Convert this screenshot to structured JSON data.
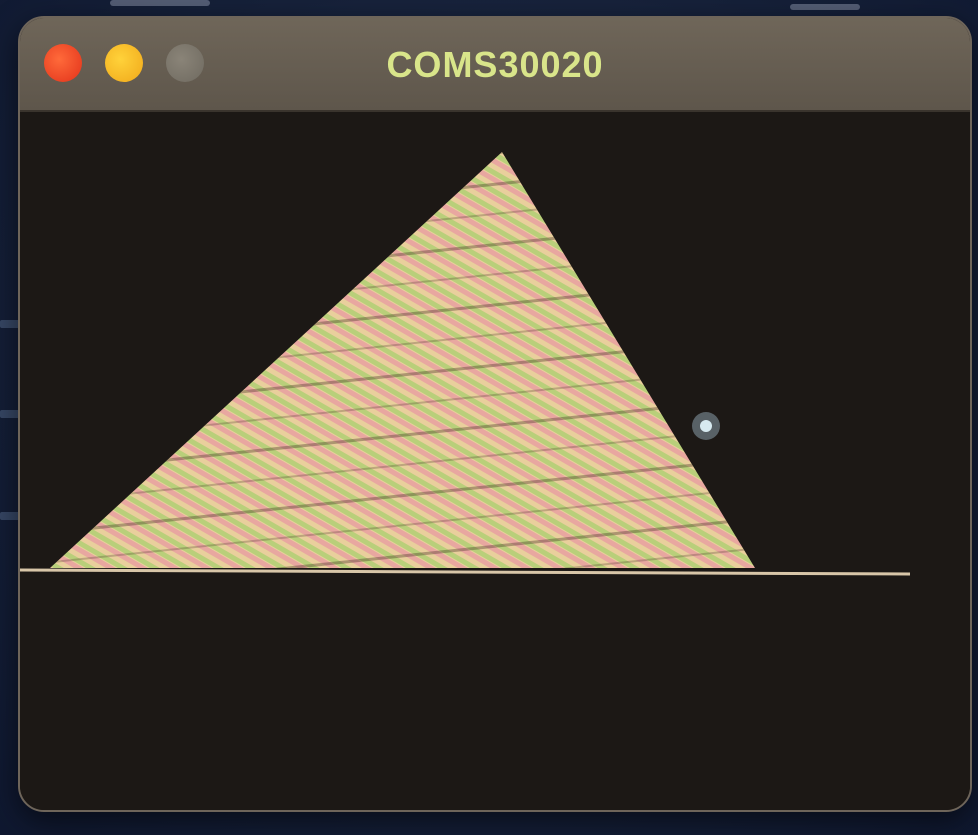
{
  "window": {
    "title": "COMS30020",
    "controls": {
      "close": "close-button",
      "minimize": "minimize-button",
      "zoom": "zoom-button"
    }
  },
  "colors": {
    "close": "#e2321a",
    "minimize": "#f0a81a",
    "zoom": "#6f6a60",
    "titlebar": "#5e564b",
    "title_text": "#d9e58a",
    "canvas_bg": "#1c1815",
    "line": "#d8c6a8",
    "stripe_pink": "#e8a7a0",
    "stripe_green": "#b9cf7a",
    "stripe_cream": "#e9cf9c"
  }
}
